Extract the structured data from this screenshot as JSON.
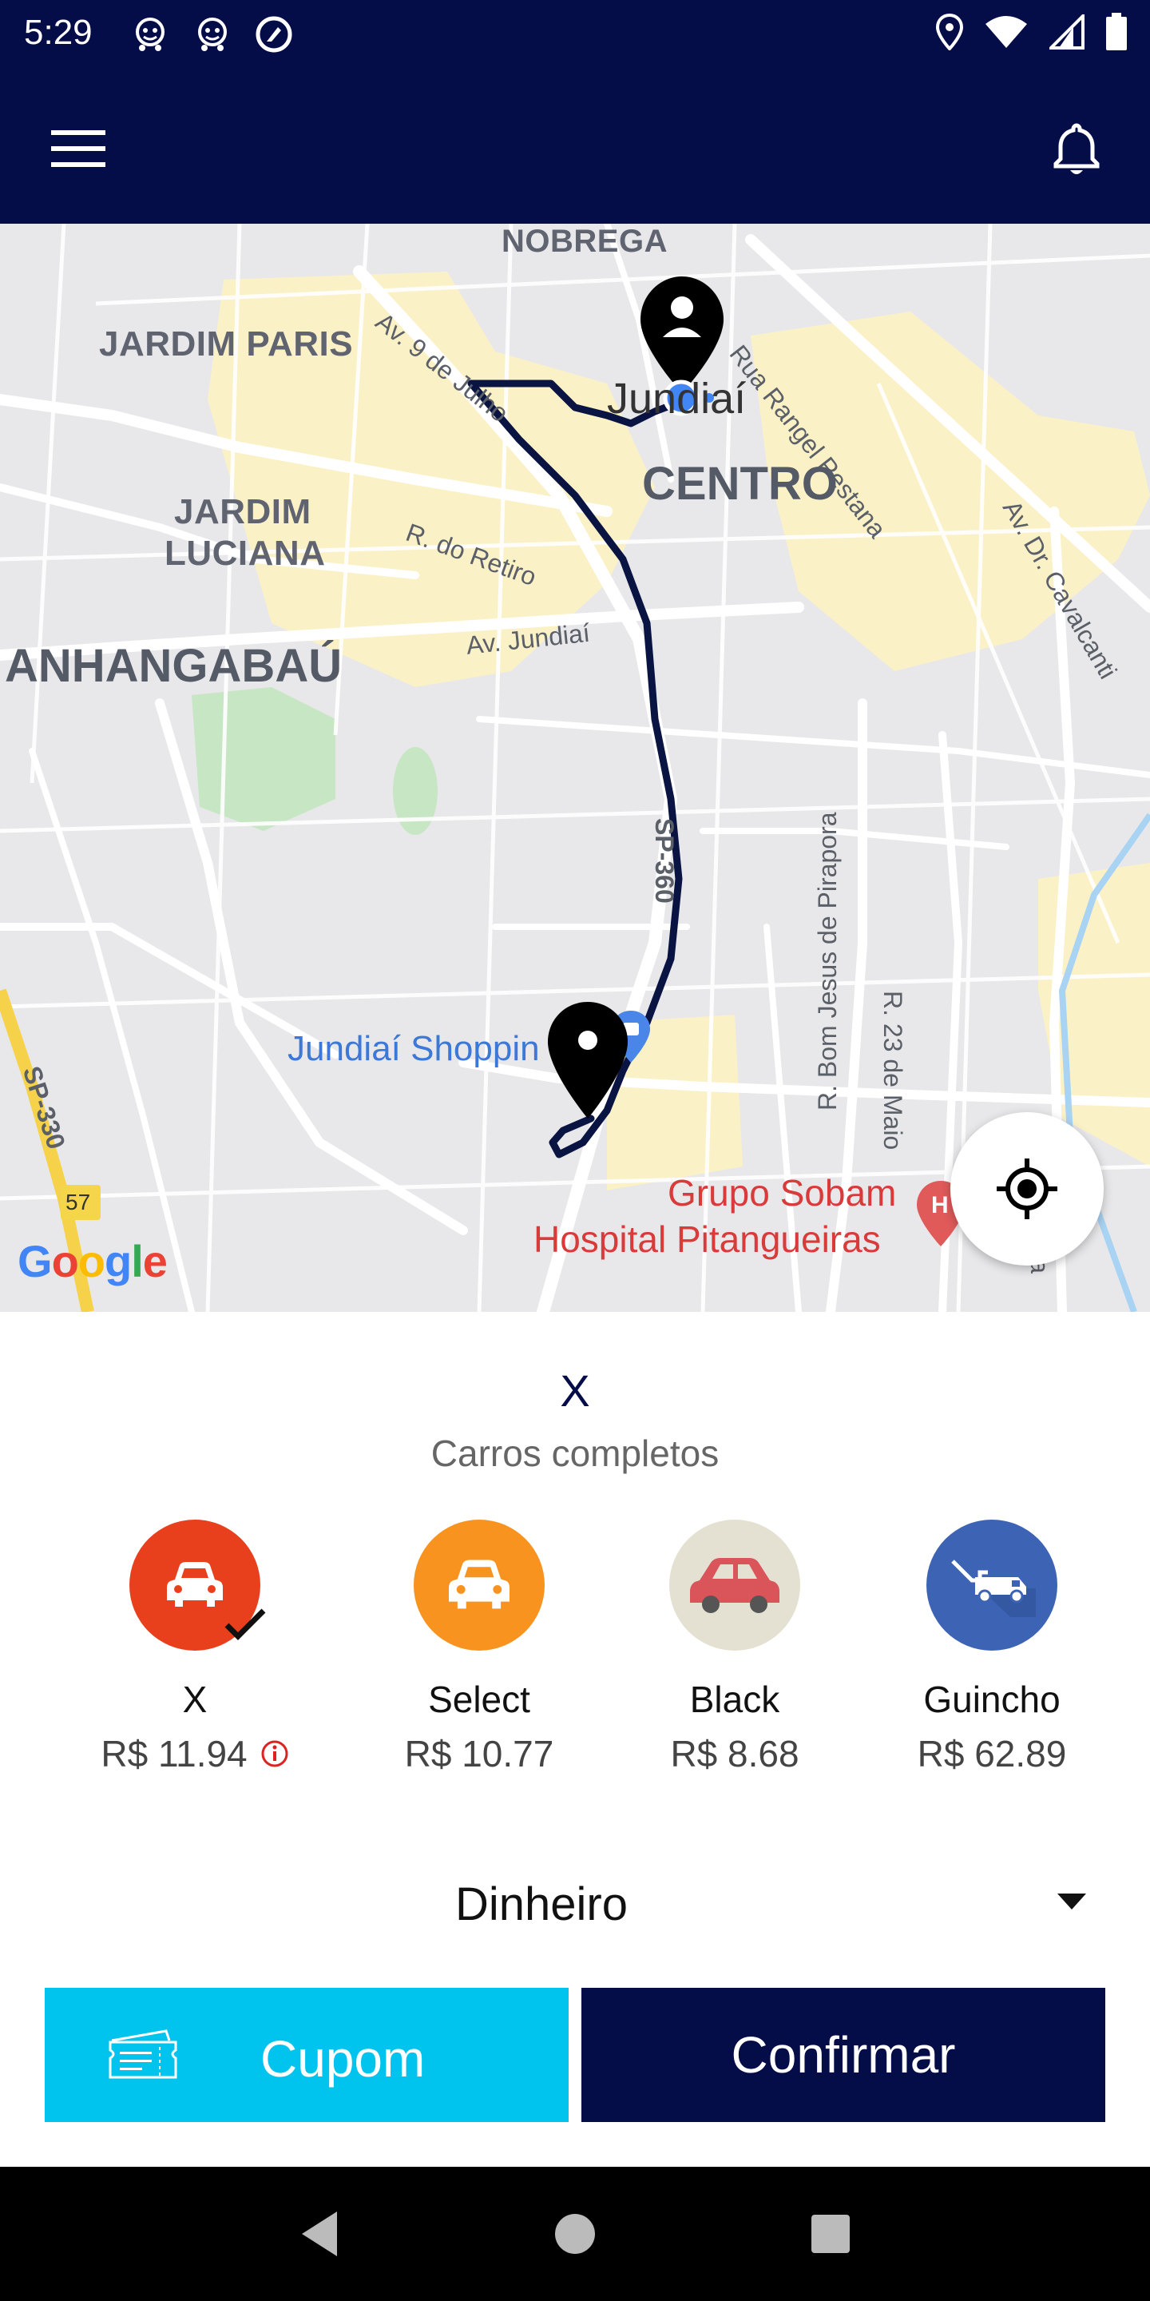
{
  "status_bar": {
    "time": "5:29",
    "left_icons": [
      "waze-icon",
      "waze-icon",
      "cast-icon"
    ],
    "right_icons": [
      "location-icon",
      "wifi-icon",
      "signal-icon",
      "battery-icon"
    ]
  },
  "app_bar": {
    "menu_icon": "hamburger-menu-icon",
    "bell_icon": "bell-icon"
  },
  "map": {
    "labels": {
      "nobrega": "NOBREGA",
      "jardim_paris": "JARDIM PARIS",
      "rua_rangel": "Rua Rangel Pestana",
      "av_9_julho": "Av. 9 de Julho",
      "jundiai": "Jundiaí",
      "centro": "CENTRO",
      "jardim_luciana_1": "JARDIM",
      "jardim_luciana_2": "LUCIANA",
      "r_retiro": "R. do Retiro",
      "av_cavalcanti": "Av. Dr. Cavalcanti",
      "anhangabau": "ANHANGABAÚ",
      "av_jundiai": "Av. Jundiaí",
      "sp_360": "SP-360",
      "r_bom_jesus": "R. Bom Jesus de Pirapora",
      "r_23_maio": "R. 23 de Maio",
      "sp_330": "SP-330",
      "road_57": "57",
      "shopping": "Jundiaí Shoppin",
      "grupo_sobam": "Grupo Sobam",
      "hospital": "Hospital Pitangueiras",
      "cica": "Cica",
      "google": "Google"
    },
    "locate_icon": "my-location-icon"
  },
  "sheet": {
    "service_title": "X",
    "service_subtitle": "Carros completos",
    "cars": [
      {
        "name": "X",
        "price": "R$ 11.94",
        "color": "#E8401C",
        "selected": true,
        "has_info": true
      },
      {
        "name": "Select",
        "price": "R$ 10.77",
        "color": "#F7931E",
        "selected": false,
        "has_info": false
      },
      {
        "name": "Black",
        "price": "R$ 8.68",
        "color": "#E4E1D3",
        "selected": false,
        "has_info": false
      },
      {
        "name": "Guincho",
        "price": "R$ 62.89",
        "color": "#3D64B4",
        "selected": false,
        "has_info": false
      }
    ],
    "payment": "Dinheiro",
    "cupom_label": "Cupom",
    "confirm_label": "Confirmar"
  },
  "colors": {
    "navy": "#040D47",
    "cyan": "#00C4EE",
    "route": "#0A1442"
  }
}
